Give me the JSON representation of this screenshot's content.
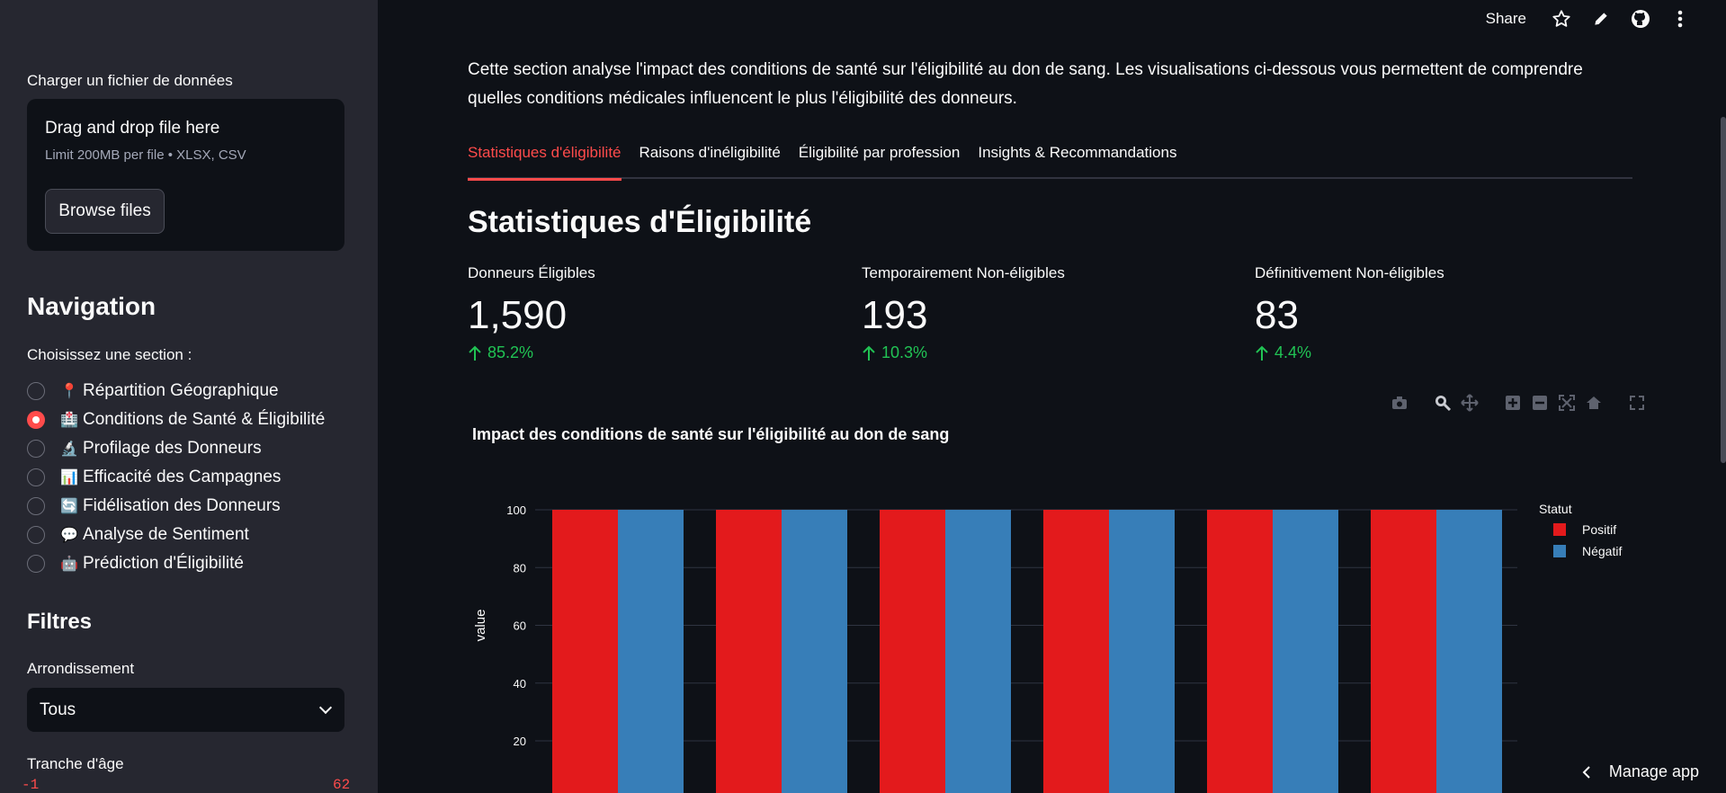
{
  "sidebar": {
    "upload_label": "Charger un fichier de données",
    "dropzone_title": "Drag and drop file here",
    "dropzone_sub": "Limit 200MB per file • XLSX, CSV",
    "browse_label": "Browse files",
    "nav_title": "Navigation",
    "nav_prompt": "Choisissez une section :",
    "nav_items": [
      {
        "emoji": "📍",
        "label": "Répartition Géographique",
        "selected": false
      },
      {
        "emoji": "🏥",
        "label": "Conditions de Santé & Éligibilité",
        "selected": true
      },
      {
        "emoji": "🔬",
        "label": "Profilage des Donneurs",
        "selected": false
      },
      {
        "emoji": "📊",
        "label": "Efficacité des Campagnes",
        "selected": false
      },
      {
        "emoji": "🔄",
        "label": "Fidélisation des Donneurs",
        "selected": false
      },
      {
        "emoji": "💬",
        "label": "Analyse de Sentiment",
        "selected": false
      },
      {
        "emoji": "🤖",
        "label": "Prédiction d'Éligibilité",
        "selected": false
      }
    ],
    "filters_title": "Filtres",
    "arrondissement_label": "Arrondissement",
    "arrondissement_value": "Tous",
    "age_label": "Tranche d'âge",
    "age_min": "-1",
    "age_max": "62"
  },
  "header": {
    "share_label": "Share"
  },
  "main": {
    "intro": "Cette section analyse l'impact des conditions de santé sur l'éligibilité au don de sang. Les visualisations ci-dessous vous permettent de comprendre quelles conditions médicales influencent le plus l'éligibilité des donneurs.",
    "tabs": [
      {
        "label": "Statistiques d'éligibilité",
        "active": true
      },
      {
        "label": "Raisons d'inéligibilité",
        "active": false
      },
      {
        "label": "Éligibilité par profession",
        "active": false
      },
      {
        "label": "Insights & Recommandations",
        "active": false
      }
    ],
    "section_title": "Statistiques d'Éligibilité",
    "metrics": [
      {
        "label": "Donneurs Éligibles",
        "value": "1,590",
        "delta": "85.2%"
      },
      {
        "label": "Temporairement Non-éligibles",
        "value": "193",
        "delta": "10.3%"
      },
      {
        "label": "Définitivement Non-éligibles",
        "value": "83",
        "delta": "4.4%"
      }
    ],
    "manage_app": "Manage app"
  },
  "colors": {
    "accent": "#ff4b4b",
    "positif": "#e31a1c",
    "negatif": "#377eb8",
    "delta_up": "#21c354"
  },
  "chart_data": {
    "type": "bar",
    "title": "Impact des conditions de santé sur l'éligibilité au don de sang",
    "xlabel": "",
    "ylabel": "value",
    "categories": [
      "",
      "",
      "",
      "",
      "",
      ""
    ],
    "series": [
      {
        "name": "Positif",
        "values": [
          100,
          100,
          100,
          100,
          100,
          100
        ]
      },
      {
        "name": "Négatif",
        "values": [
          100,
          100,
          100,
          100,
          100,
          100
        ]
      }
    ],
    "yticks": [
      20,
      40,
      60,
      80,
      100
    ],
    "ylim": [
      0,
      100
    ],
    "legend_title": "Statut",
    "legend_position": "top-right",
    "grid": true
  }
}
